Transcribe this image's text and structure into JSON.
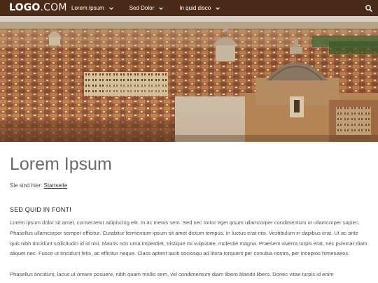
{
  "nav": {
    "logo_bold": "LOGO",
    "logo_light": ".COM",
    "items": [
      {
        "label": "Lorem Ipsum"
      },
      {
        "label": "Sed Dolor"
      },
      {
        "label": "In quid disco"
      }
    ],
    "bg_color": "#4a2a18"
  },
  "page": {
    "title": "Lorem Ipsum",
    "breadcrumb_prefix": "Sie sind hier:",
    "breadcrumb_link": "Startseite",
    "section_heading": "SED QUID IN FONTI",
    "paragraph1": "Lorem ipsum dolor sit amet, consectetur adipiscing elit. In ac metus sem. Sed nec tortor eget ipsum ullamcorper condimentum ut ullamcorper sapien. Phasellus ullamcorper semper efficitur. Curabitur fermentum ipsum sit amet dictum tempus. In luctus erat nisi. Vestibulum in dapibus erat. Ut ac ante quis nibh tincidunt sollicitudin id id nisi. Mauris non urna imperdiet, tristique mi vulputate, molestie magna. Praesent viverra turpis erat, nec pulvinar diam aliquet nec. Fusce ut tincidunt felis, ac efficitur neque. Class aptent taciti sociosqu ad litora torquent per conubia nostra, per inceptos himenaeos.",
    "paragraph2": "Phasellus tincidunt, lacus ut ornare posuere, nibh quam mollis sem, vel condimentum diam libero blandit libero. Donec vitae turpis id enim"
  },
  "icons": {
    "search": "search-icon",
    "chevron": "chevron-down-icon"
  }
}
